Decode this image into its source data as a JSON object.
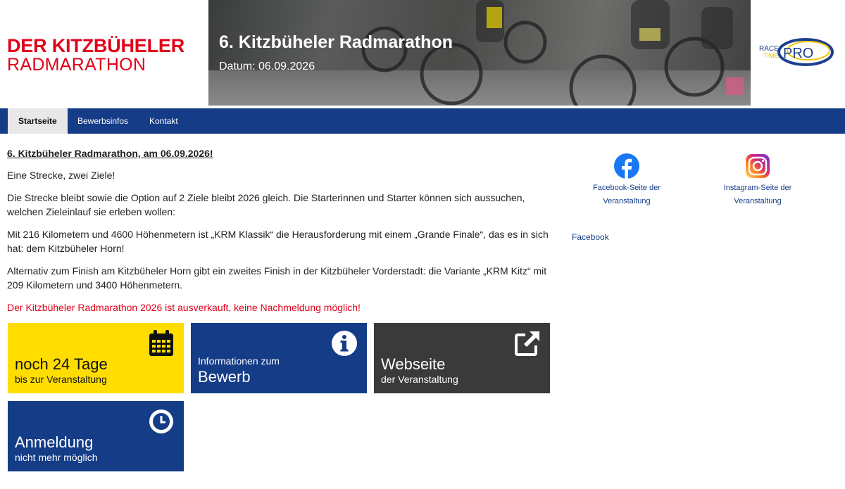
{
  "header": {
    "logo_line1": "DER KITZBÜHELER",
    "logo_line2": "RADMARATHON",
    "event_title": "6. Kitzbüheler Radmarathon",
    "event_date": "Datum: 06.09.2026",
    "partner_logo_line1": "RACE",
    "partner_logo_line2": "TIME",
    "partner_logo_pro": "PRO"
  },
  "nav": {
    "items": [
      "Startseite",
      "Bewerbsinfos",
      "Kontakt"
    ],
    "active": "Startseite"
  },
  "content": {
    "headline": "6. Kitzbüheler Radmarathon, am 06.09.2026!",
    "p1": "Eine Strecke, zwei Ziele!",
    "p2": "Die Strecke bleibt sowie die Option auf 2 Ziele bleibt 2026 gleich. Die Starterinnen und Starter können sich aussuchen, welchen Zieleinlauf sie erleben wollen:",
    "p3": "Mit 216 Kilometern und 4600 Höhenmetern ist „KRM Klassik“ die Herausforderung mit einem „Grande Finale“, das es in sich hat: dem Kitzbüheler Horn!",
    "p4": "Alternativ zum Finish am Kitzbüheler Horn gibt ein zweites Finish in der Kitzbüheler Vorderstadt: die Variante „KRM Kitz“ mit 209 Kilometern und 3400 Höhenmetern.",
    "notice": "Der Kitzbüheler Radmarathon 2026 ist ausverkauft, keine Nachmeldung möglich!"
  },
  "tiles": {
    "days": {
      "big": "noch 24 Tage",
      "small": "bis zur Veranstaltung",
      "icon": "calendar-icon",
      "color": "#ffdd00"
    },
    "info": {
      "small": "Informationen zum",
      "big": "Bewerb",
      "icon": "info-icon",
      "color": "#143c87"
    },
    "web": {
      "big": "Webseite",
      "small": "der Veranstaltung",
      "icon": "external-link-icon",
      "color": "#3a3a3a"
    },
    "reg": {
      "big": "Anmeldung",
      "small": "nicht mehr möglich",
      "icon": "clock-icon",
      "color": "#143c87"
    }
  },
  "sidebar": {
    "facebook_label_1": "Facebook-Seite der",
    "facebook_label_2": "Veranstaltung",
    "instagram_label_1": "Instagram-Seite der",
    "instagram_label_2": "Veranstaltung",
    "facebook_link": "Facebook"
  },
  "colors": {
    "brand_red": "#e2001a",
    "nav_blue": "#143c87",
    "tile_yellow": "#ffdd00",
    "tile_dark": "#3a3a3a"
  }
}
